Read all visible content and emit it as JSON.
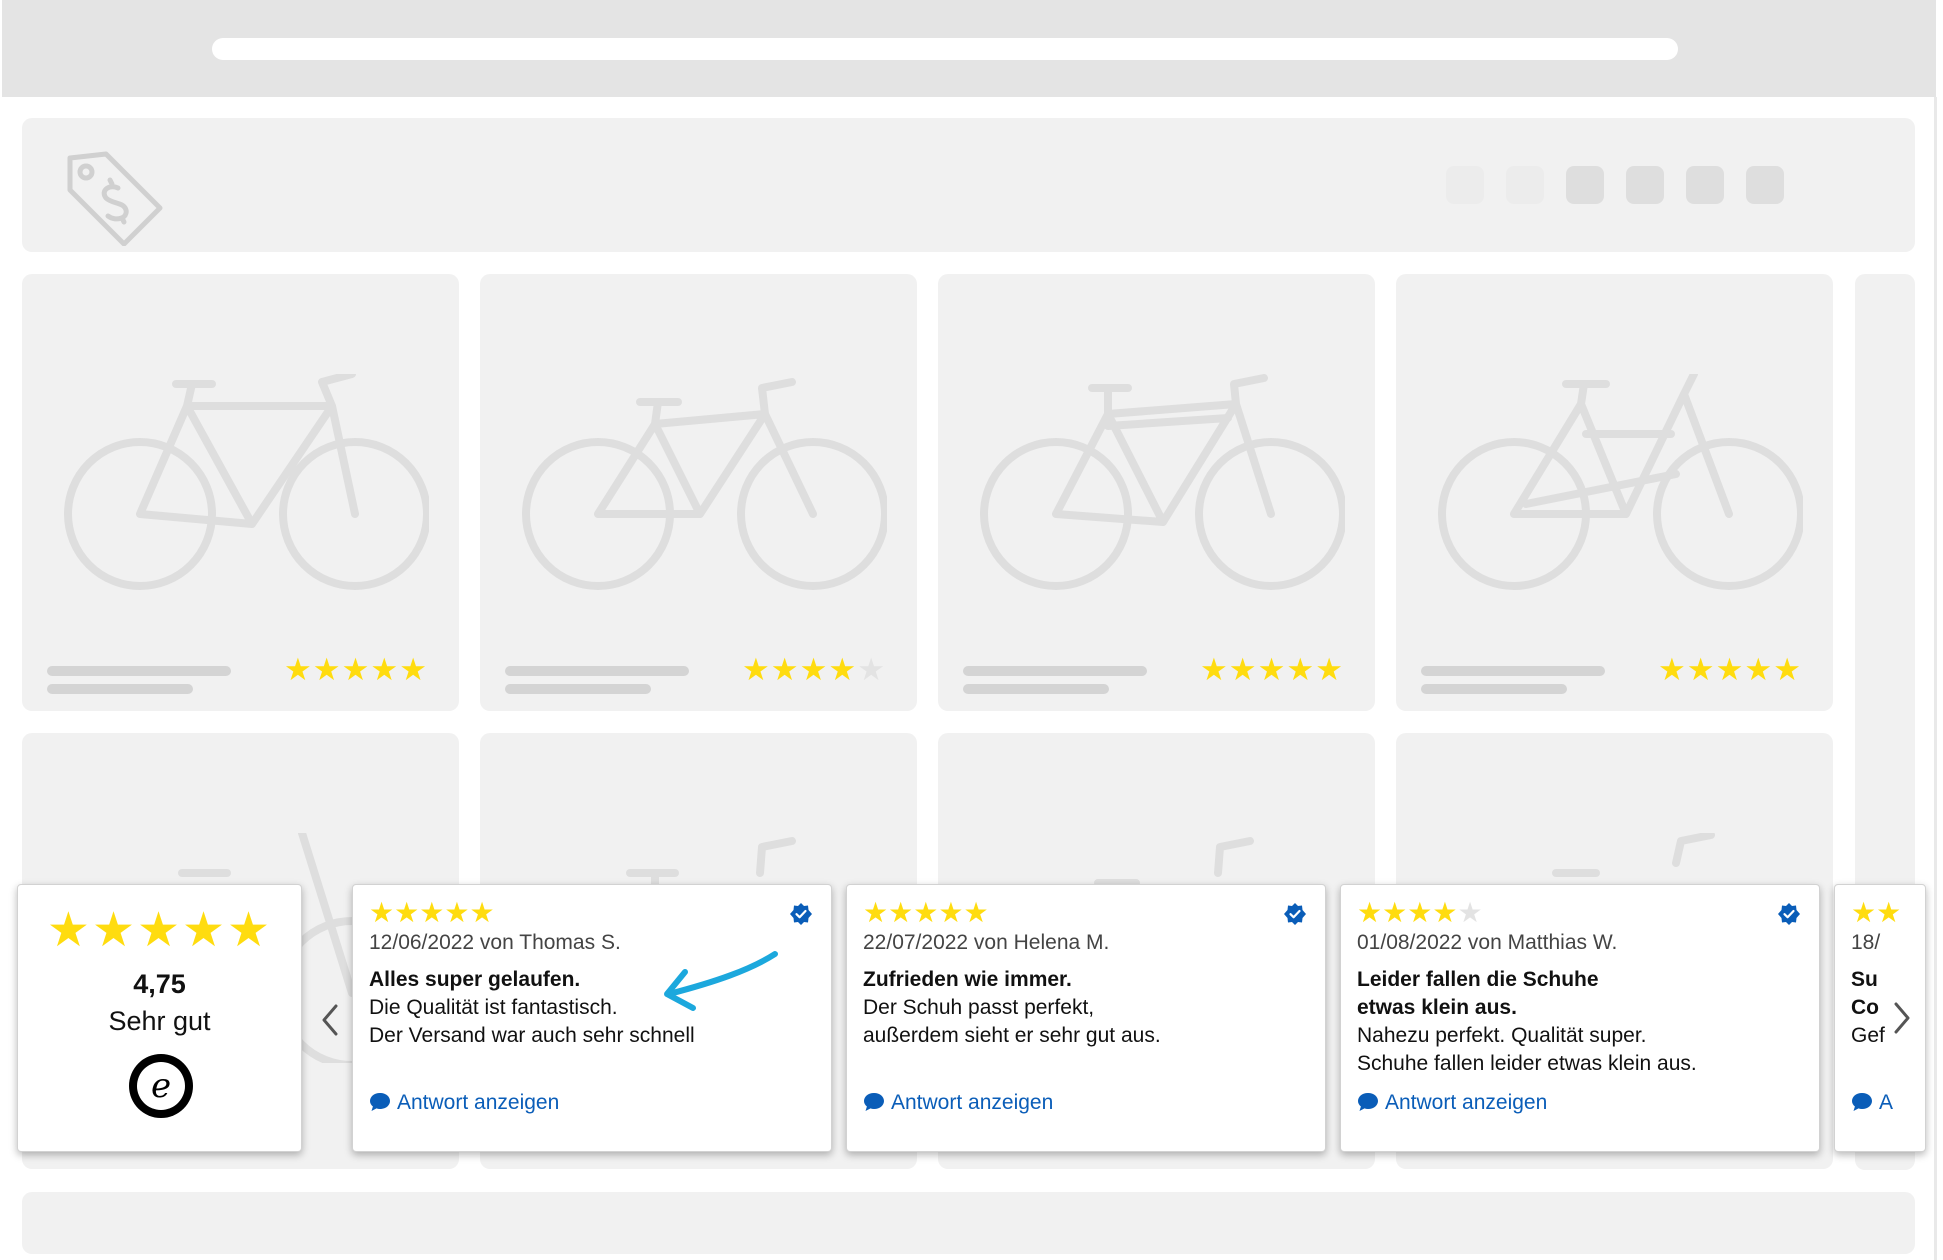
{
  "theme": {
    "star_color": "#ffdc0f",
    "star_empty_color": "#e3e3e3",
    "link_color": "#0a5db8",
    "verified_color": "#0a5db8",
    "annotation_arrow_color": "#1ca8dd"
  },
  "shop_header": {
    "logo_icon": "price-tag-dollar-icon",
    "nav_dots": 6
  },
  "products": [
    {
      "rating": 5
    },
    {
      "rating": 4
    },
    {
      "rating": 5
    },
    {
      "rating": 5
    }
  ],
  "rating_summary": {
    "stars": 5,
    "score": "4,75",
    "label": "Sehr gut",
    "badge_letter": "e"
  },
  "reviews": [
    {
      "stars": 5,
      "meta": "12/06/2022 von Thomas S.",
      "title_lines": [
        "Alles super gelaufen."
      ],
      "body_lines": [
        "Die Qualität ist fantastisch.",
        "Der Versand war auch sehr schnell"
      ],
      "reply_label": "Antwort anzeigen"
    },
    {
      "stars": 5,
      "meta": "22/07/2022 von Helena M.",
      "title_lines": [
        "Zufrieden wie immer."
      ],
      "body_lines": [
        "Der Schuh passt perfekt,",
        "außerdem sieht er sehr gut aus."
      ],
      "reply_label": "Antwort anzeigen"
    },
    {
      "stars": 4,
      "meta": "01/08/2022 von Matthias W.",
      "title_lines": [
        "Leider fallen die Schuhe",
        "etwas klein aus."
      ],
      "body_lines": [
        "Nahezu perfekt. Qualität super.",
        "Schuhe fallen leider etwas klein aus."
      ],
      "reply_label": "Antwort anzeigen"
    },
    {
      "stars": 2,
      "meta": "18/",
      "title_lines": [
        "Su",
        "Co"
      ],
      "body_lines": [
        "Gef"
      ],
      "reply_label": "A"
    }
  ],
  "carousel": {
    "prev_icon": "chevron-left-icon",
    "next_icon": "chevron-right-icon"
  }
}
